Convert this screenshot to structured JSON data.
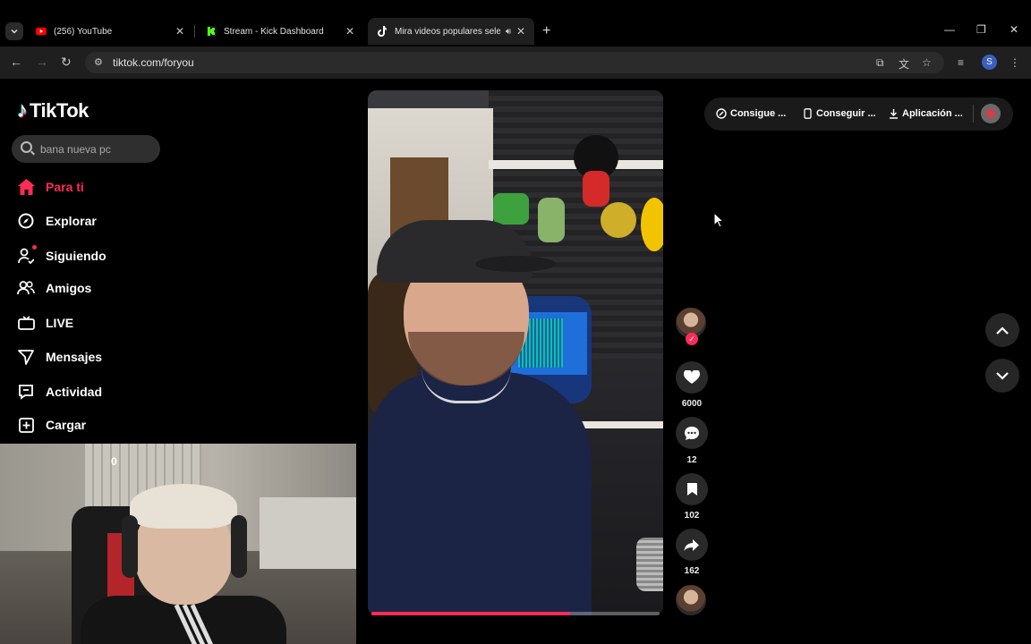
{
  "browser": {
    "tabs": [
      {
        "title": "(256) YouTube",
        "icon": "youtube-icon"
      },
      {
        "title": "Stream - Kick Dashboard",
        "icon": "kick-icon"
      },
      {
        "title": "Mira videos populares selec",
        "icon": "tiktok-icon",
        "active": true
      }
    ],
    "url": "tiktok.com/foryou",
    "profile_initial": "S"
  },
  "tiktok": {
    "logo_text": "TikTok",
    "search_placeholder": "bana nueva pc",
    "nav": [
      {
        "label": "Para ti",
        "icon": "home-icon",
        "active": true
      },
      {
        "label": "Explorar",
        "icon": "compass-icon"
      },
      {
        "label": "Siguiendo",
        "icon": "following-icon"
      },
      {
        "label": "Amigos",
        "icon": "friends-icon"
      },
      {
        "label": "LIVE",
        "icon": "live-icon"
      },
      {
        "label": "Mensajes",
        "icon": "messages-icon"
      },
      {
        "label": "Actividad",
        "icon": "activity-icon"
      },
      {
        "label": "Cargar",
        "icon": "upload-icon"
      }
    ],
    "actions": {
      "likes": "6000",
      "comments": "12",
      "saves": "102",
      "shares": "162"
    },
    "video_progress": 0.69,
    "top_pills": [
      "Consigue ...",
      "Conseguir ...",
      "Aplicación ..."
    ]
  },
  "webcam": {
    "counter": "0"
  },
  "colors": {
    "accent": "#fe2c55",
    "background": "#000000",
    "chrome": "#1f1f1f"
  }
}
